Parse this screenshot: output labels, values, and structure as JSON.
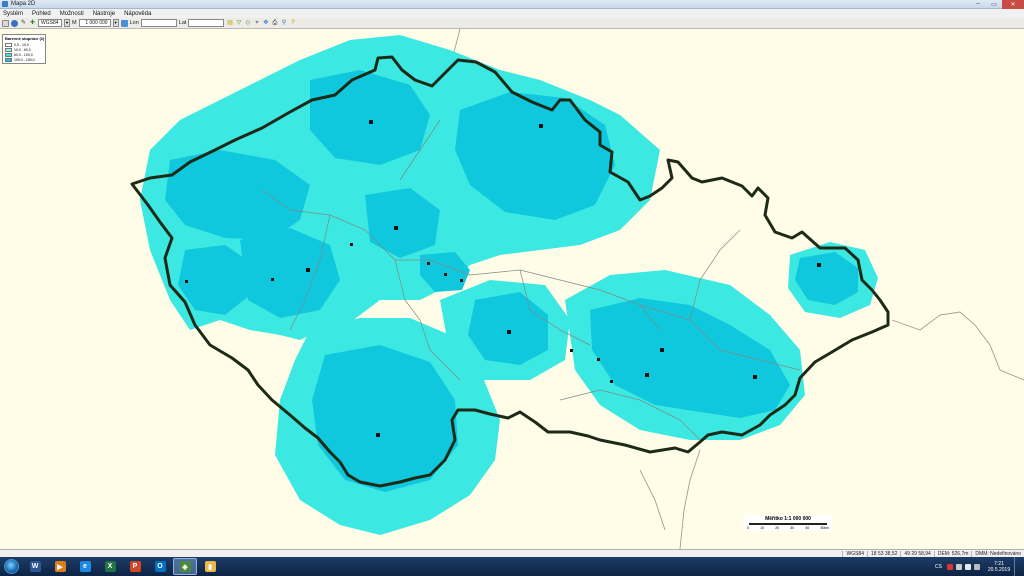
{
  "window": {
    "title": "Mapa 2D"
  },
  "menu": [
    "Systém",
    "Pohled",
    "Možnosti",
    "Nástroje",
    "Nápověda"
  ],
  "toolbar": {
    "crs": "WGS84",
    "scale_label": "M",
    "scale_value": "1 000 000",
    "lon_label": "Lon",
    "lon_value": "",
    "lat_label": "Lat",
    "lat_value": ""
  },
  "legend": {
    "title": "Barevné stupnice (2)",
    "rows": [
      {
        "label": "0,0 - 10,0",
        "color": "#ffffff"
      },
      {
        "label": "10,0 - 60,0",
        "color": "#9ef4ef"
      },
      {
        "label": "60,0 - 100,0",
        "color": "#3ce8e2"
      },
      {
        "label": "100,0 - 150,0",
        "color": "#10c8dd"
      }
    ]
  },
  "map": {
    "background_color": "#fffde8",
    "coverage_colors": [
      "#3ce8e2",
      "#10c8dd"
    ],
    "border_color": "#1e2a18"
  },
  "scalebar": {
    "title": "Měřítko 1:1 000 000",
    "ticks": [
      "0",
      "10",
      "20",
      "30",
      "40",
      "50km"
    ]
  },
  "statusbar": [
    "WGS84",
    "18 53 38,52",
    "49 29 58,94",
    "DEM: 526,7m",
    "DMM: Nedefinováno"
  ],
  "taskbar": {
    "apps": [
      {
        "name": "word",
        "letter": "W",
        "color": "#2b5797"
      },
      {
        "name": "media-player",
        "letter": "▶",
        "color": "#e07b1a"
      },
      {
        "name": "internet-explorer",
        "letter": "e",
        "color": "#1e88e5"
      },
      {
        "name": "excel",
        "letter": "X",
        "color": "#217346"
      },
      {
        "name": "powerpoint",
        "letter": "P",
        "color": "#d24726"
      },
      {
        "name": "outlook",
        "letter": "O",
        "color": "#0072c6"
      },
      {
        "name": "mapa-2d",
        "letter": "◈",
        "color": "#4a8a3a"
      },
      {
        "name": "file-explorer",
        "letter": "▮",
        "color": "#e8b84a"
      }
    ],
    "language": "CS",
    "time": "7:21",
    "date": "20.5.2019"
  }
}
